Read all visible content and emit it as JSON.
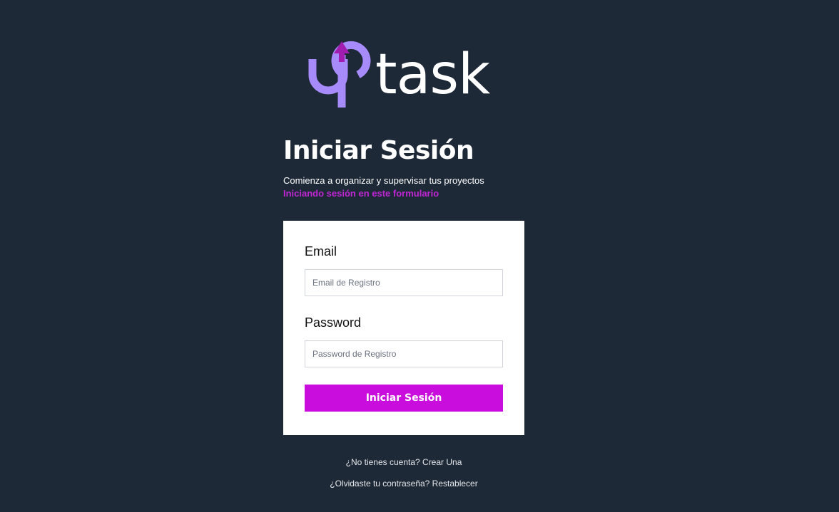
{
  "brand": {
    "name": "uptask",
    "logo_part_1": "up",
    "logo_part_2": "task",
    "accent_color": "#a78bfa",
    "arrow_color": "#a21caf"
  },
  "header": {
    "title": "Iniciar Sesión",
    "subtitle": "Comienza a organizar y supervisar tus proyectos",
    "subtitle_accent": "Iniciando sesión en este formulario"
  },
  "form": {
    "email_label": "Email",
    "email_placeholder": "Email de Registro",
    "email_value": "",
    "password_label": "Password",
    "password_placeholder": "Password de Registro",
    "password_value": "",
    "submit_label": "Iniciar Sesión"
  },
  "links": {
    "register": "¿No tienes cuenta? Crear Una",
    "forgot": "¿Olvidaste tu contraseña? Restablecer"
  },
  "colors": {
    "background": "#1e2937",
    "primary_button": "#c80ddc",
    "accent_text": "#c026d3"
  }
}
